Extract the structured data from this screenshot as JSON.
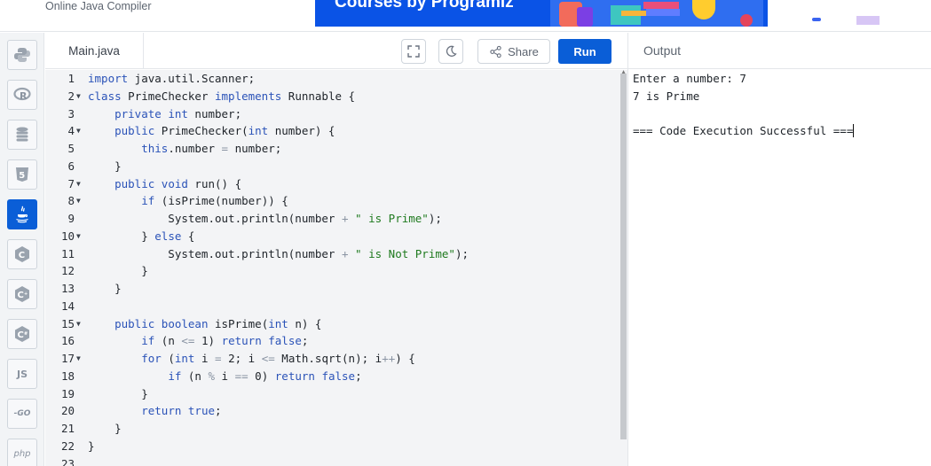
{
  "header": {
    "brand": "Online Java Compiler",
    "banner_text": "Courses by Programiz"
  },
  "sidebar": {
    "languages": [
      {
        "name": "python",
        "icon": "python-icon",
        "label": ""
      },
      {
        "name": "r",
        "icon": "r-icon",
        "label": "R"
      },
      {
        "name": "sql",
        "icon": "database-icon",
        "label": ""
      },
      {
        "name": "html",
        "icon": "html5-icon",
        "label": "5"
      },
      {
        "name": "java",
        "icon": "java-icon",
        "label": "",
        "active": true
      },
      {
        "name": "c",
        "icon": "c-icon",
        "label": "C"
      },
      {
        "name": "cpp",
        "icon": "cpp-icon",
        "label": "C"
      },
      {
        "name": "csharp",
        "icon": "csharp-icon",
        "label": "C"
      },
      {
        "name": "javascript",
        "icon": "js-icon",
        "label": "JS"
      },
      {
        "name": "go",
        "icon": "go-icon",
        "label": "-GO"
      },
      {
        "name": "php",
        "icon": "php-icon",
        "label": "php"
      }
    ]
  },
  "editor": {
    "tab_label": "Main.java",
    "share_label": "Share",
    "run_label": "Run",
    "lines": [
      {
        "n": "1",
        "fold": false,
        "code": "import java.util.Scanner;"
      },
      {
        "n": "2",
        "fold": true,
        "code": "class PrimeChecker implements Runnable {"
      },
      {
        "n": "3",
        "fold": false,
        "code": "    private int number;"
      },
      {
        "n": "4",
        "fold": true,
        "code": "    public PrimeChecker(int number) {"
      },
      {
        "n": "5",
        "fold": false,
        "code": "        this.number = number;"
      },
      {
        "n": "6",
        "fold": false,
        "code": "    }"
      },
      {
        "n": "7",
        "fold": true,
        "code": "    public void run() {"
      },
      {
        "n": "8",
        "fold": true,
        "code": "        if (isPrime(number)) {"
      },
      {
        "n": "9",
        "fold": false,
        "code": "            System.out.println(number + \" is Prime\");"
      },
      {
        "n": "10",
        "fold": true,
        "code": "        } else {"
      },
      {
        "n": "11",
        "fold": false,
        "code": "            System.out.println(number + \" is Not Prime\");"
      },
      {
        "n": "12",
        "fold": false,
        "code": "        }"
      },
      {
        "n": "13",
        "fold": false,
        "code": "    }"
      },
      {
        "n": "14",
        "fold": false,
        "code": ""
      },
      {
        "n": "15",
        "fold": true,
        "code": "    public boolean isPrime(int n) {"
      },
      {
        "n": "16",
        "fold": false,
        "code": "        if (n <= 1) return false;"
      },
      {
        "n": "17",
        "fold": true,
        "code": "        for (int i = 2; i <= Math.sqrt(n); i++) {"
      },
      {
        "n": "18",
        "fold": false,
        "code": "            if (n % i == 0) return false;"
      },
      {
        "n": "19",
        "fold": false,
        "code": "        }"
      },
      {
        "n": "20",
        "fold": false,
        "code": "        return true;"
      },
      {
        "n": "21",
        "fold": false,
        "code": "    }"
      },
      {
        "n": "22",
        "fold": false,
        "code": "}"
      },
      {
        "n": "23",
        "fold": false,
        "code": ""
      }
    ]
  },
  "output": {
    "title": "Output",
    "lines": [
      "Enter a number: 7",
      "7 is Prime",
      "",
      "=== Code Execution Successful ==="
    ]
  }
}
